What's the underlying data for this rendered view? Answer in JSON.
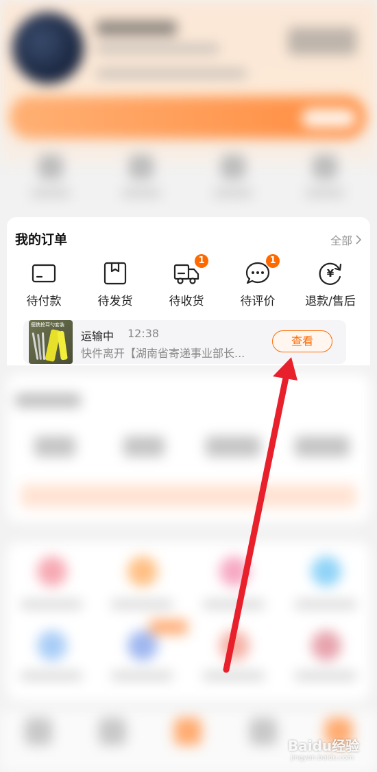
{
  "orders": {
    "title": "我的订单",
    "view_all": "全部",
    "statuses": [
      {
        "label": "待付款",
        "icon": "wallet-card-icon",
        "badge": ""
      },
      {
        "label": "待发货",
        "icon": "package-box-icon",
        "badge": ""
      },
      {
        "label": "待收货",
        "icon": "delivery-truck-icon",
        "badge": "1"
      },
      {
        "label": "待评价",
        "icon": "chat-bubble-icon",
        "badge": "1"
      },
      {
        "label": "退款/售后",
        "icon": "refund-yuan-icon",
        "badge": ""
      }
    ],
    "shipment": {
      "status": "运输中",
      "time": "12:38",
      "description": "快件离开【湖南省寄递事业部长...",
      "view_button": "查看",
      "thumbnail_caption": "便携挖耳勺套装"
    }
  },
  "colors": {
    "accent": "#ff6a00",
    "arrow": "#e8202c"
  },
  "watermark": {
    "brand": "Baidu经验",
    "url": "jingyan.baidu.com"
  }
}
